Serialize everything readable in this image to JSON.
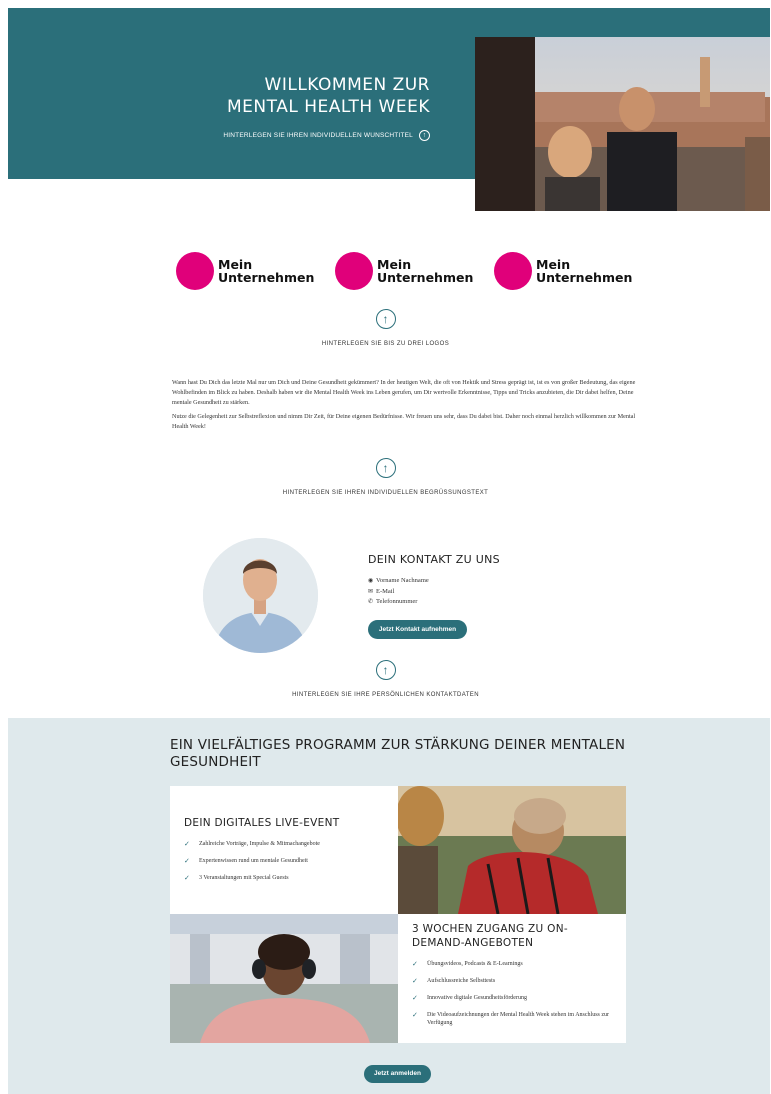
{
  "hero": {
    "title_line1": "WILLKOMMEN ZUR",
    "title_line2": "MENTAL HEALTH WEEK",
    "subtitle": "HINTERLEGEN SIE IHREN INDIVIDUELLEN WUNSCHTITEL"
  },
  "logos": {
    "items": [
      {
        "line1": "Mein",
        "line2": "Unternehmen"
      },
      {
        "line1": "Mein",
        "line2": "Unternehmen"
      },
      {
        "line1": "Mein",
        "line2": "Unternehmen"
      }
    ],
    "upload_label": "HINTERLEGEN SIE BIS ZU DREI LOGOS",
    "brand_color": "#e0007a"
  },
  "welcome": {
    "paragraph1": "Wann hast Du Dich das letzte Mal nur um Dich und Deine Gesundheit gekümmert? In der heutigen Welt, die oft von Hektik und Stress geprägt ist, ist es von großer Bedeutung, das eigene Wohlbefinden im Blick zu haben. Deshalb haben wir die Mental Health Week ins Leben gerufen, um Dir wertvolle Erkenntnisse, Tipps und Tricks anzubieten, die Dir dabei helfen, Deine mentale Gesundheit zu stärken.",
    "paragraph2": "Nutze die Gelegenheit zur Selbstreflexion und nimm Dir Zeit, für Deine eigenen Bedürfnisse. Wir freuen uns sehr, dass Du dabei bist. Daher noch einmal herzlich willkommen zur Mental Health Week!",
    "upload_label": "HINTERLEGEN SIE IHREN INDIVIDUELLEN BEGRÜSSUNGSTEXT"
  },
  "contact": {
    "title": "DEIN KONTAKT ZU UNS",
    "name": "Vorname Nachname",
    "email": "E-Mail",
    "phone": "Telefonnummer",
    "button": "Jetzt Kontakt aufnehmen",
    "upload_label": "HINTERLEGEN SIE IHRE PERSÖNLICHEN KONTAKTDATEN"
  },
  "program": {
    "title": "EIN VIELFÄLTIGES PROGRAMM ZUR STÄRKUNG DEINER MENTALEN GESUNDHEIT",
    "live_event": {
      "title": "DEIN DIGITALES LIVE-EVENT",
      "items": [
        "Zahlreiche Vorträge, Impulse & Mitmachangebote",
        "Expertenwissen rund um mentale Gesundheit",
        "3 Veranstaltungen mit Special Guests"
      ]
    },
    "on_demand": {
      "title_line1": "3 WOCHEN ZUGANG ZU ON-",
      "title_line2": "DEMAND-ANGEBOTEN",
      "items": [
        "Übungsvideos, Podcasts & E-Learnings",
        "Aufschlussreiche Selbsttests",
        "Innovative digitale Gesundheitsförderung",
        "Die Videoaufzeichnungen der Mental Health Week stehen im Anschluss zur Verfügung"
      ]
    },
    "button": "Jetzt anmelden"
  },
  "colors": {
    "teal": "#2b6f7a",
    "program_bg": "#dfe9ec"
  }
}
